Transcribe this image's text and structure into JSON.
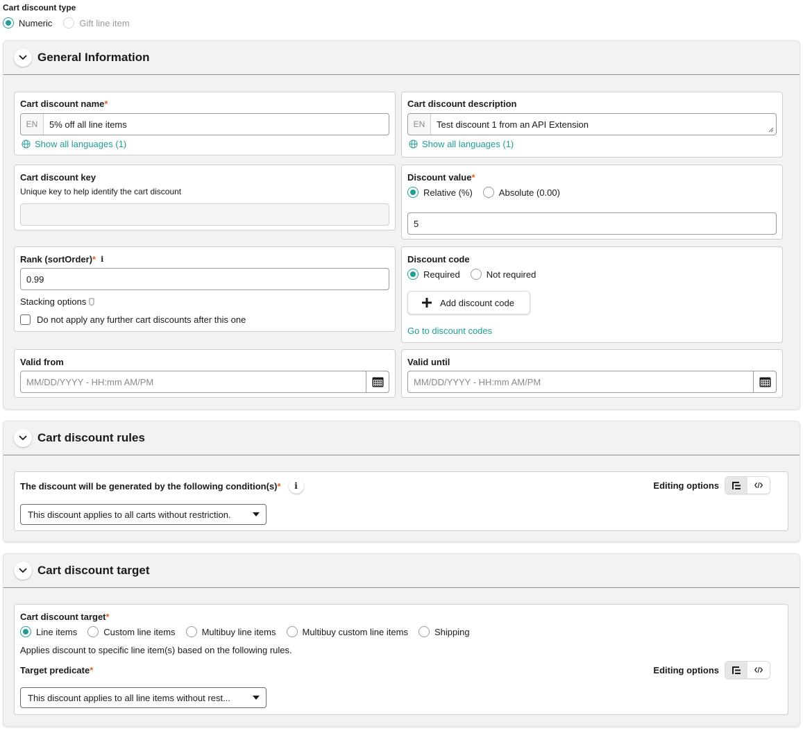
{
  "discount_type": {
    "label": "Cart discount type",
    "options": [
      "Numeric",
      "Gift line item"
    ],
    "selected": "Numeric"
  },
  "general": {
    "title": "General Information",
    "name": {
      "label": "Cart discount name",
      "required_mark": "*",
      "lang": "EN",
      "value": "5% off all line items",
      "show_languages": "Show all languages (1)"
    },
    "description": {
      "label": "Cart discount description",
      "lang": "EN",
      "value": "Test discount 1 from an API Extension",
      "show_languages": "Show all languages (1)"
    },
    "key": {
      "label": "Cart discount key",
      "hint": "Unique key to help identify the cart discount",
      "value": ""
    },
    "value": {
      "label": "Discount value",
      "required_mark": "*",
      "options": [
        "Relative (%)",
        "Absolute (0.00)"
      ],
      "selected": "Relative (%)",
      "value": "5"
    },
    "rank": {
      "label": "Rank (sortOrder)",
      "required_mark": "*",
      "info": "i",
      "value": "0.99",
      "stacking_label": "Stacking options",
      "checkbox_label": "Do not apply any further cart discounts after this one"
    },
    "code": {
      "label": "Discount code",
      "options": [
        "Required",
        "Not required"
      ],
      "selected": "Required",
      "add_button": "Add discount code",
      "link": "Go to discount codes"
    },
    "valid_from": {
      "label": "Valid from",
      "placeholder": "MM/DD/YYYY - HH:mm AM/PM"
    },
    "valid_until": {
      "label": "Valid until",
      "placeholder": "MM/DD/YYYY - HH:mm AM/PM"
    }
  },
  "rules": {
    "title": "Cart discount rules",
    "condition_label": "The discount will be generated by the following condition(s)",
    "required_mark": "*",
    "info": "i",
    "editing_options": "Editing options",
    "select_value": "This discount applies to all carts without restriction."
  },
  "target": {
    "title": "Cart discount target",
    "label": "Cart discount target",
    "required_mark": "*",
    "options": [
      "Line items",
      "Custom line items",
      "Multibuy line items",
      "Multibuy custom line items",
      "Shipping"
    ],
    "selected": "Line items",
    "description": "Applies discount to specific line item(s) based on the following rules.",
    "predicate_label": "Target predicate",
    "editing_options": "Editing options",
    "select_value": "This discount applies to all line items without rest..."
  },
  "colors": {
    "accent": "#1e9e94",
    "required": "#e0661f",
    "panel_bg": "#f2f2f2"
  }
}
